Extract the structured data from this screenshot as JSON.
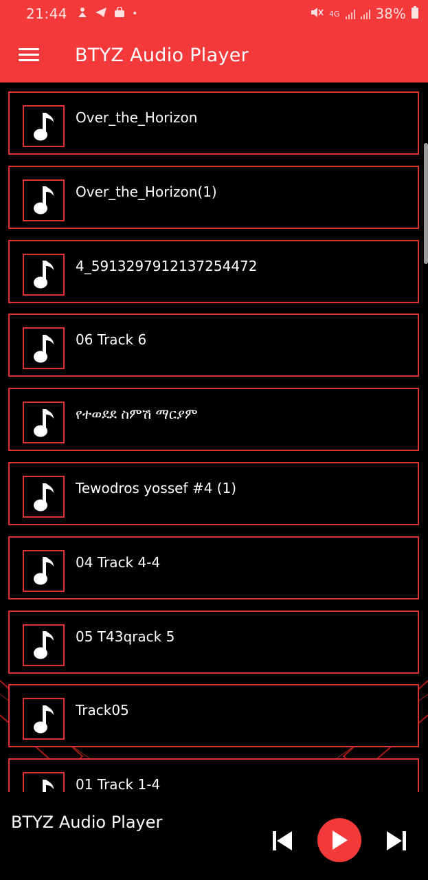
{
  "status_bar": {
    "time": "21:44",
    "notifications": [
      "pinned-icon",
      "telegram-icon",
      "bag-icon",
      "dot"
    ],
    "network": "4G",
    "battery": "38%"
  },
  "app_bar": {
    "title": "BTYZ Audio Player"
  },
  "tracks": [
    {
      "title": "Over_the_Horizon"
    },
    {
      "title": "Over_the_Horizon(1)"
    },
    {
      "title": "4_5913297912137254472"
    },
    {
      "title": "06 Track 6"
    },
    {
      "title": "የተወደደ ስምሽ ማርያም"
    },
    {
      "title": "Tewodros yossef #4 (1)"
    },
    {
      "title": "04 Track 4-4"
    },
    {
      "title": "05 T43qrack 5"
    },
    {
      "title": "Track05"
    },
    {
      "title": "01 Track 1-4"
    }
  ],
  "player": {
    "now_playing": "BTYZ Audio Player"
  },
  "colors": {
    "accent": "#f3393a",
    "border": "#e0322f",
    "background": "#000000"
  }
}
